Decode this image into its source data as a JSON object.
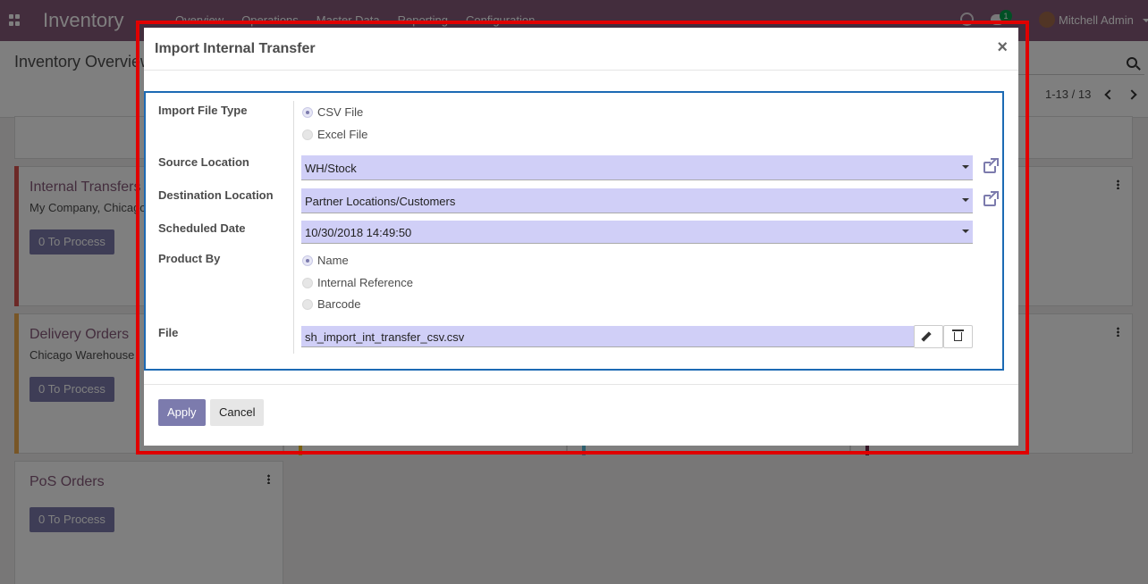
{
  "navbar": {
    "brand": "Inventory",
    "menu": [
      "Overview",
      "Operations",
      "Master Data",
      "Reporting",
      "Configuration"
    ],
    "chat_badge": "1",
    "user_name": "Mitchell Admin"
  },
  "control_panel": {
    "breadcrumb": "Inventory Overview",
    "pager": "1-13 / 13"
  },
  "kanban": {
    "cards": [
      {
        "title": "Internal Transfers",
        "subtitle": "My Company, Chicago",
        "button": "0 To Process",
        "strip_color": "#d9534f"
      },
      {
        "title": "Delivery Orders",
        "subtitle": "Chicago Warehouse",
        "button": "0 To Process",
        "strip_color": "#f0ad4e"
      },
      {
        "title": "PoS Orders",
        "subtitle": "",
        "button": "0 To Process",
        "strip_color": ""
      }
    ]
  },
  "modal": {
    "title": "Import Internal Transfer",
    "close_glyph": "×",
    "import_file_type": {
      "label": "Import File Type",
      "options": [
        "CSV File",
        "Excel File"
      ],
      "selected": "CSV File"
    },
    "source_location": {
      "label": "Source Location",
      "value": "WH/Stock"
    },
    "destination_location": {
      "label": "Destination Location",
      "value": "Partner Locations/Customers"
    },
    "scheduled_date": {
      "label": "Scheduled Date",
      "value": "10/30/2018 14:49:50"
    },
    "product_by": {
      "label": "Product By",
      "options": [
        "Name",
        "Internal Reference",
        "Barcode"
      ],
      "selected": "Name"
    },
    "file": {
      "label": "File",
      "value": "sh_import_int_transfer_csv.csv"
    },
    "apply_label": "Apply",
    "cancel_label": "Cancel"
  },
  "colors": {
    "navbar": "#875a7b",
    "accent": "#7c7bad",
    "field_bg": "#d0cff7",
    "form_border": "#1c6ab4",
    "highlight": "#e00000"
  }
}
